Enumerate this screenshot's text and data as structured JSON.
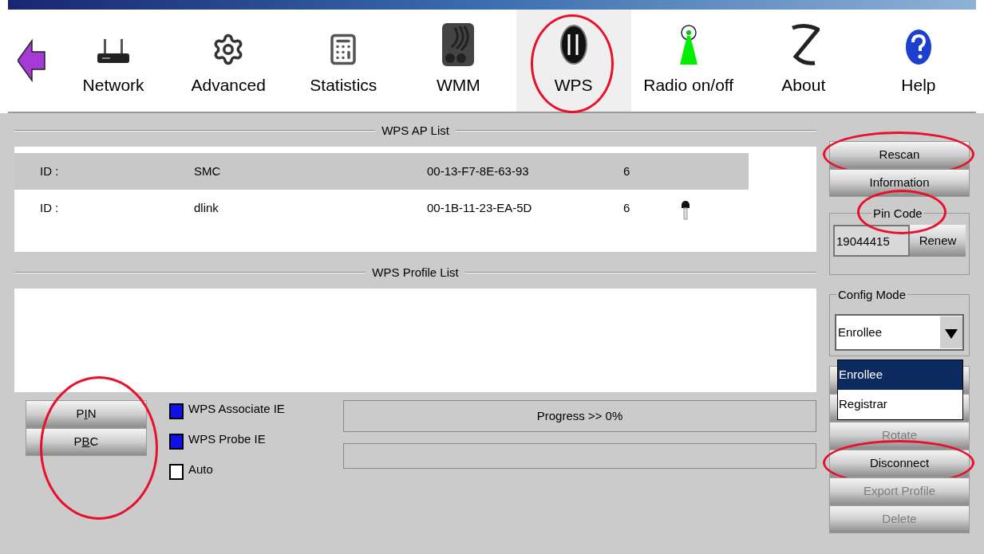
{
  "toolbar": [
    {
      "kind": "network",
      "label": "Network",
      "selected": false,
      "circled": false
    },
    {
      "kind": "advanced",
      "label": "Advanced",
      "selected": false,
      "circled": false
    },
    {
      "kind": "statistics",
      "label": "Statistics",
      "selected": false,
      "circled": false
    },
    {
      "kind": "wmm",
      "label": "WMM",
      "selected": false,
      "circled": false
    },
    {
      "kind": "wps",
      "label": "WPS",
      "selected": true,
      "circled": true
    },
    {
      "kind": "radio",
      "label": "Radio on/off",
      "selected": false,
      "circled": false
    },
    {
      "kind": "about",
      "label": "About",
      "selected": false,
      "circled": false
    },
    {
      "kind": "help",
      "label": "Help",
      "selected": false,
      "circled": false
    }
  ],
  "ap_list": {
    "title": "WPS AP List",
    "rows": [
      {
        "id": "ID :",
        "ssid": "SMC",
        "mac": "00-13-F7-8E-63-93",
        "channel": "6",
        "locked": false,
        "selected": true
      },
      {
        "id": "ID :",
        "ssid": "dlink",
        "mac": "00-1B-11-23-EA-5D",
        "channel": "6",
        "locked": true,
        "selected": false
      }
    ]
  },
  "profile_list": {
    "title": "WPS Profile List"
  },
  "mode_buttons": {
    "circled": true,
    "buttons": [
      {
        "before": "P",
        "mnemonic": "I",
        "after": "N"
      },
      {
        "before": "P",
        "mnemonic": "B",
        "after": "C"
      }
    ]
  },
  "options": [
    {
      "label": "WPS Associate IE",
      "checked": true
    },
    {
      "label": "WPS Probe IE",
      "checked": true
    },
    {
      "label": "Auto",
      "checked": false
    }
  ],
  "progress": {
    "text": "Progress >> 0%",
    "level": 0
  },
  "side_top_buttons": [
    {
      "label": "Rescan",
      "disabled": false,
      "circled": true
    },
    {
      "label": "Information",
      "disabled": false,
      "circled": false
    }
  ],
  "pin_code": {
    "title": "Pin Code",
    "circled": true,
    "value": "19044415",
    "button": "Renew"
  },
  "config_mode": {
    "title": "Config Mode",
    "value": "Enrollee",
    "options": [
      {
        "label": "Enrollee",
        "selected": true
      },
      {
        "label": "Registrar",
        "selected": false
      }
    ]
  },
  "side_bottom_buttons": [
    {
      "label": "Rotate",
      "disabled": true,
      "circled": false
    },
    {
      "label": "Disconnect",
      "disabled": false,
      "circled": true
    },
    {
      "label": "Export Profile",
      "disabled": true,
      "circled": false
    },
    {
      "label": "Delete",
      "disabled": true,
      "circled": false
    }
  ]
}
